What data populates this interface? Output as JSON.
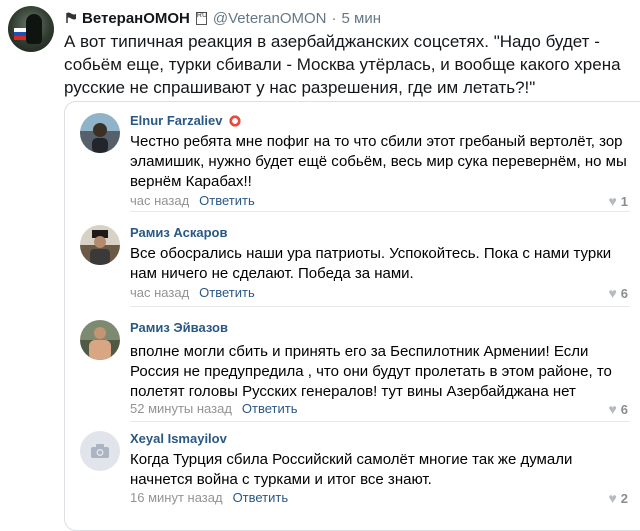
{
  "tweet": {
    "retweet_icon": "russian-flag-emoji",
    "author_name": "ВетеранОМОН",
    "badge": "RU",
    "handle": "@VeteranOMON",
    "separator": "·",
    "time": "5 мин",
    "text": "А вот типичная реакция в азербайджанских соцсетях. \"Надо будет - собьём еще, турки сбивали - Москва утёрлась, и вообще какого хрена русские не спрашивают у нас разрешения, где им летать?!\""
  },
  "comments": [
    {
      "name": "Elnur Farzaliev",
      "has_emoji": true,
      "text": "Честно ребята мне пофиг на то что сбили этот гребаный вертолёт, зор эламишик, нужно будет ещё собьём, весь мир сука перевернём, но мы вернём Карабах!!",
      "time": "час назад",
      "reply": "Ответить",
      "likes": "1"
    },
    {
      "name": "Рамиз Аскаров",
      "has_emoji": false,
      "text": "Все обосрались наши ура патриоты. Успокойтесь. Пока с нами турки нам ничего не сделают. Победа за нами.",
      "time": "час назад",
      "reply": "Ответить",
      "likes": "6"
    },
    {
      "name": "Рамиз Эйвазов",
      "has_emoji": false,
      "text": "вполне могли сбить и принять его за Беспилотник Армении! Если Россия не предупредила , что они будут пролетать в этом районе, то полетят головы Русских генералов! тут вины Азербайджана нет",
      "time": "52 минуты назад",
      "reply": "Ответить",
      "likes": "6"
    },
    {
      "name": "Xeyal Ismayilov",
      "has_emoji": false,
      "text": "Когда Турция сбила Российский самолёт многие так же думали начнется война с турками и итог все знают.",
      "time": "16 минут назад",
      "reply": "Ответить",
      "likes": "2"
    }
  ],
  "colors": {
    "link_blue": "#2a5885",
    "meta_gray": "#939393",
    "handle_gray": "#657786"
  }
}
